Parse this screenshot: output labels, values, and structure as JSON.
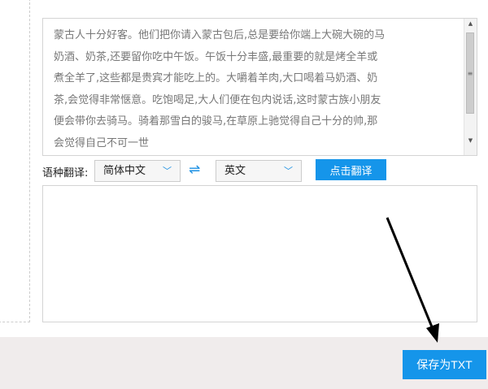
{
  "source_text": "蒙古人十分好客。他们把你请入蒙古包后,总是要给你端上大碗大碗的马奶酒、奶茶,还要留你吃中午饭。午饭十分丰盛,最重要的就是烤全羊或煮全羊了,这些都是贵宾才能吃上的。大嚼着羊肉,大口喝着马奶酒、奶茶,会觉得非常惬意。吃饱喝足,大人们便在包内说话,这时蒙古族小朋友便会带你去骑马。骑着那雪白的骏马,在草原上驰觉得自己十分的帅,那会觉得自己不可一世",
  "lang_label": "语种翻译:",
  "source_lang": "简体中文",
  "target_lang": "英文",
  "translate_button": "点击翻译",
  "output_text": "",
  "save_button": "保存为TXT",
  "accent": "#1595ea"
}
